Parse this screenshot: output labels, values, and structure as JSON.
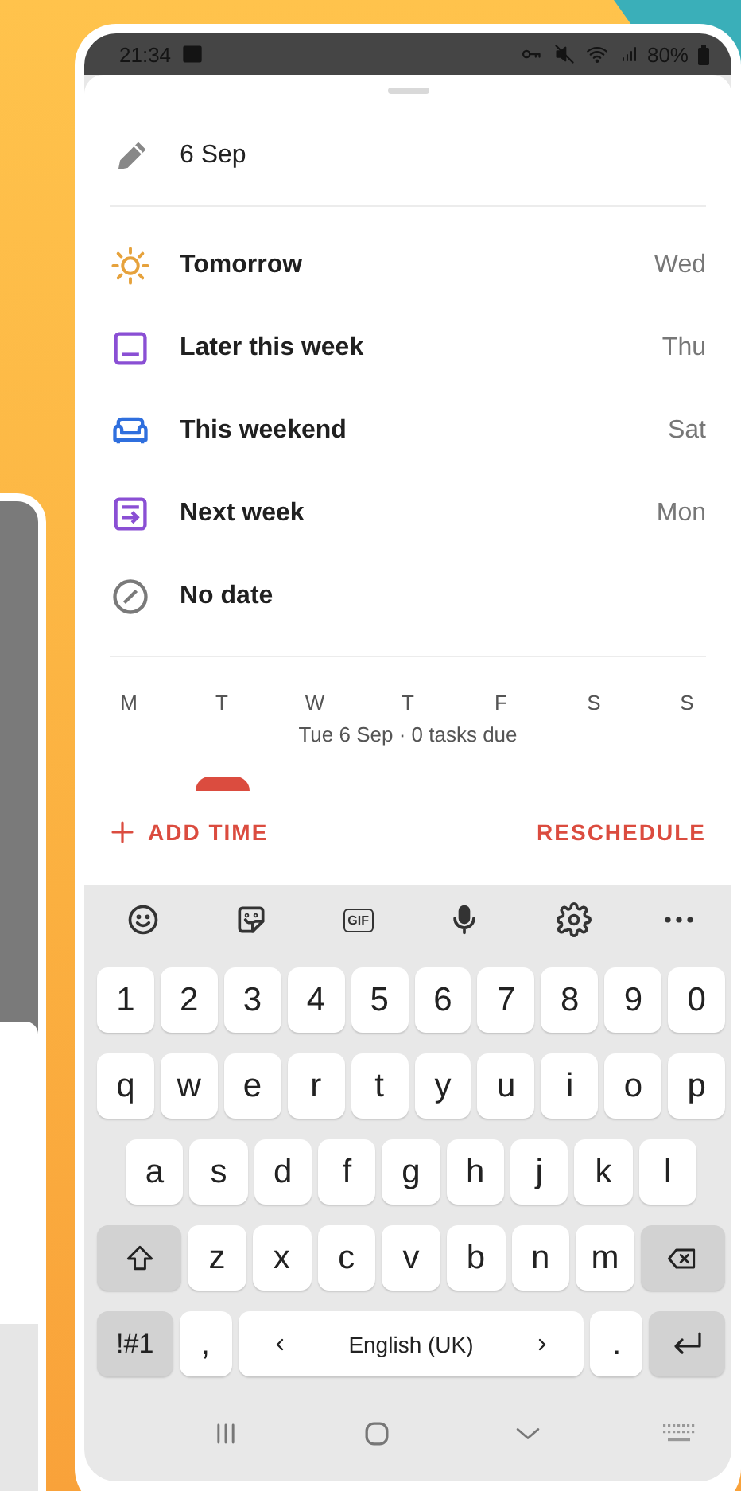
{
  "status_bar": {
    "time": "21:34",
    "battery": "80%"
  },
  "sheet": {
    "date_field": {
      "value": "6 Sep"
    },
    "options": [
      {
        "kind": "tomorrow",
        "label": "Tomorrow",
        "day": "Wed",
        "color": "#e6a23c"
      },
      {
        "kind": "later_this_week",
        "label": "Later this week",
        "day": "Thu",
        "color": "#8a4fd4"
      },
      {
        "kind": "this_weekend",
        "label": "This weekend",
        "day": "Sat",
        "color": "#2f6fde"
      },
      {
        "kind": "next_week",
        "label": "Next week",
        "day": "Mon",
        "color": "#8a4fd4"
      },
      {
        "kind": "no_date",
        "label": "No date",
        "color": "#7a7a7a"
      }
    ],
    "week": {
      "days": [
        {
          "label": "M",
          "selected": false
        },
        {
          "label": "T",
          "selected": true
        },
        {
          "label": "W",
          "selected": false
        },
        {
          "label": "T",
          "selected": false
        },
        {
          "label": "F",
          "selected": false
        },
        {
          "label": "S",
          "selected": false
        },
        {
          "label": "S",
          "selected": false
        }
      ],
      "summary": "Tue 6 Sep · 0 tasks due"
    },
    "actions": {
      "add_time": "ADD TIME",
      "reschedule": "RESCHEDULE"
    }
  },
  "keyboard": {
    "toolbar": [
      {
        "kind": "emoji"
      },
      {
        "kind": "sticker"
      },
      {
        "kind": "gif",
        "label": "GIF"
      },
      {
        "kind": "mic"
      },
      {
        "kind": "settings"
      },
      {
        "kind": "more"
      }
    ],
    "rows": [
      {
        "keys": [
          {
            "kind": "char",
            "label": "1"
          },
          {
            "kind": "char",
            "label": "2"
          },
          {
            "kind": "char",
            "label": "3"
          },
          {
            "kind": "char",
            "label": "4"
          },
          {
            "kind": "char",
            "label": "5"
          },
          {
            "kind": "char",
            "label": "6"
          },
          {
            "kind": "char",
            "label": "7"
          },
          {
            "kind": "char",
            "label": "8"
          },
          {
            "kind": "char",
            "label": "9"
          },
          {
            "kind": "char",
            "label": "0"
          }
        ]
      },
      {
        "keys": [
          {
            "kind": "char",
            "label": "q"
          },
          {
            "kind": "char",
            "label": "w"
          },
          {
            "kind": "char",
            "label": "e"
          },
          {
            "kind": "char",
            "label": "r"
          },
          {
            "kind": "char",
            "label": "t"
          },
          {
            "kind": "char",
            "label": "y"
          },
          {
            "kind": "char",
            "label": "u"
          },
          {
            "kind": "char",
            "label": "i"
          },
          {
            "kind": "char",
            "label": "o"
          },
          {
            "kind": "char",
            "label": "p"
          }
        ]
      },
      {
        "keys": [
          {
            "kind": "char",
            "label": "a"
          },
          {
            "kind": "char",
            "label": "s"
          },
          {
            "kind": "char",
            "label": "d"
          },
          {
            "kind": "char",
            "label": "f"
          },
          {
            "kind": "char",
            "label": "g"
          },
          {
            "kind": "char",
            "label": "h"
          },
          {
            "kind": "char",
            "label": "j"
          },
          {
            "kind": "char",
            "label": "k"
          },
          {
            "kind": "char",
            "label": "l"
          }
        ]
      },
      {
        "keys": [
          {
            "kind": "shift"
          },
          {
            "kind": "char",
            "label": "z"
          },
          {
            "kind": "char",
            "label": "x"
          },
          {
            "kind": "char",
            "label": "c"
          },
          {
            "kind": "char",
            "label": "v"
          },
          {
            "kind": "char",
            "label": "b"
          },
          {
            "kind": "char",
            "label": "n"
          },
          {
            "kind": "char",
            "label": "m"
          },
          {
            "kind": "backspace"
          }
        ]
      },
      {
        "keys": [
          {
            "kind": "symbols",
            "label": "!#1"
          },
          {
            "kind": "char",
            "label": ","
          },
          {
            "kind": "space",
            "label": "English (UK)"
          },
          {
            "kind": "char",
            "label": "."
          },
          {
            "kind": "enter"
          }
        ]
      }
    ]
  },
  "nav_bar": [
    {
      "kind": "recents"
    },
    {
      "kind": "home"
    },
    {
      "kind": "hide_keyboard"
    },
    {
      "kind": "keyboard_switch"
    }
  ]
}
